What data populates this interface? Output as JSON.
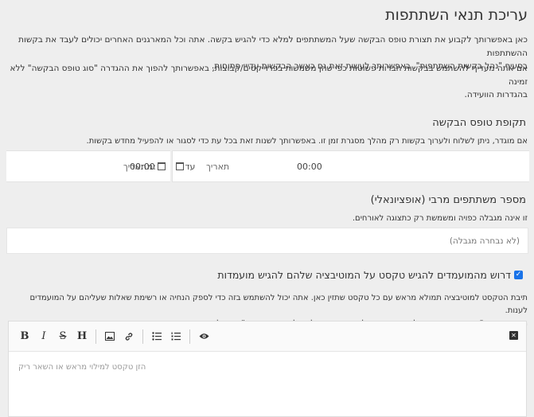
{
  "page": {
    "title": "עריכת תנאי השתתפות",
    "intro_line1": "כאן באפשרותך לקבוע את תצורת טופס הבקשה שעל המשתתפים למלא כדי להגיש בקשה. אתה וכל המארגנים האחרים יכולים לעבד את בקשות ההשתתפות",
    "intro_line2": "בסעיף \"נהל בקשות השתתפות\". באפשרותך לעשות זאת גם כאשר הבקשות עדיין פתוחות.",
    "intro2_line1": "אם אתה מעדיף להשתמש בבקשות חברות פשוטות כפי שהן משמשות בפרוייקטים/קבוצות, באפשרותך להפוך את ההגדרה \"סוג טופס הבקשה\" ללא זמינה",
    "intro2_line2": "בהגדרות הוועידה."
  },
  "period": {
    "title": "תקופת טופס הבקשה",
    "desc": "אם מוגדר, ניתן לשלוח ולערוך בקשות רק מהלך מסגרת זמן זו. באפשרותך לשנות זאת בכל עת כדי לסגור או להפעיל מחדש בקשות.",
    "from": {
      "label": "מ:",
      "date_placeholder": "תאריך",
      "time": "00:00",
      "icon": "calendar-icon"
    },
    "to": {
      "label": "עד",
      "date_placeholder": "תאריך",
      "time": "00:00",
      "icon": "calendar-icon"
    }
  },
  "max_participants": {
    "title": "מספר משתתפים מרבי (אופציונאלי)",
    "desc": "זו אינה מגבלה כפויה ומשמשת רק כתצוגה לאורחים.",
    "placeholder": "(לא נבחרה מגבלה)"
  },
  "require_motivation": {
    "label": "דרוש מהמועמדים להגיש טקסט על המוטיבציה שלהם להגיש מועמדות",
    "checked": true
  },
  "motivation": {
    "desc_line1": "תיבת הטקסט למוטיבציה תמולא מראש עם כל טקסט שתזין כאן. אתה יכול להשתמש בזה כדי לספק הנחיה או רשימת שאלות שעליהם על המועמדים לענות.",
    "desc_line2": "תקף רק אם \"דרוש מהמועמדים להגיש טקסט על המוטיבציה שלהם להגיש מועמדות\" מופעל.",
    "placeholder": "הזן טקסט למילוי מראש או השאר ריק"
  },
  "toolbar": {
    "bold": "B",
    "italic": "I",
    "strike": "S",
    "heading": "H",
    "image_icon": "image-icon",
    "link_icon": "link-icon",
    "ul_icon": "bulleted-list-icon",
    "ol_icon": "numbered-list-icon",
    "preview_icon": "eye-icon",
    "close_icon": "close-icon"
  },
  "colors": {
    "checkbox": "#1a73e8",
    "background": "#eeeeee"
  }
}
